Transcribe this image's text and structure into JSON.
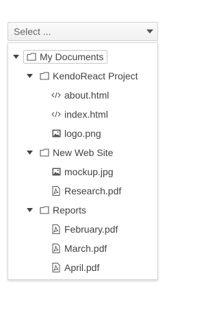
{
  "dropdown": {
    "value": "Select ...",
    "arrow_icon": "caret-down-icon"
  },
  "tree": {
    "root": {
      "label": "My Documents",
      "icon": "folder-icon"
    },
    "folder1": {
      "label": "KendoReact Project",
      "icon": "folder-icon"
    },
    "folder1_items": [
      {
        "label": "about.html",
        "icon": "code-icon"
      },
      {
        "label": "index.html",
        "icon": "code-icon"
      },
      {
        "label": "logo.png",
        "icon": "image-icon"
      }
    ],
    "folder2": {
      "label": "New Web Site",
      "icon": "folder-icon"
    },
    "folder2_items": [
      {
        "label": "mockup.jpg",
        "icon": "image-icon"
      },
      {
        "label": "Research.pdf",
        "icon": "pdf-icon"
      }
    ],
    "folder3": {
      "label": "Reports",
      "icon": "folder-icon"
    },
    "folder3_items": [
      {
        "label": "February.pdf",
        "icon": "pdf-icon"
      },
      {
        "label": "March.pdf",
        "icon": "pdf-icon"
      },
      {
        "label": "April.pdf",
        "icon": "pdf-icon"
      }
    ]
  }
}
